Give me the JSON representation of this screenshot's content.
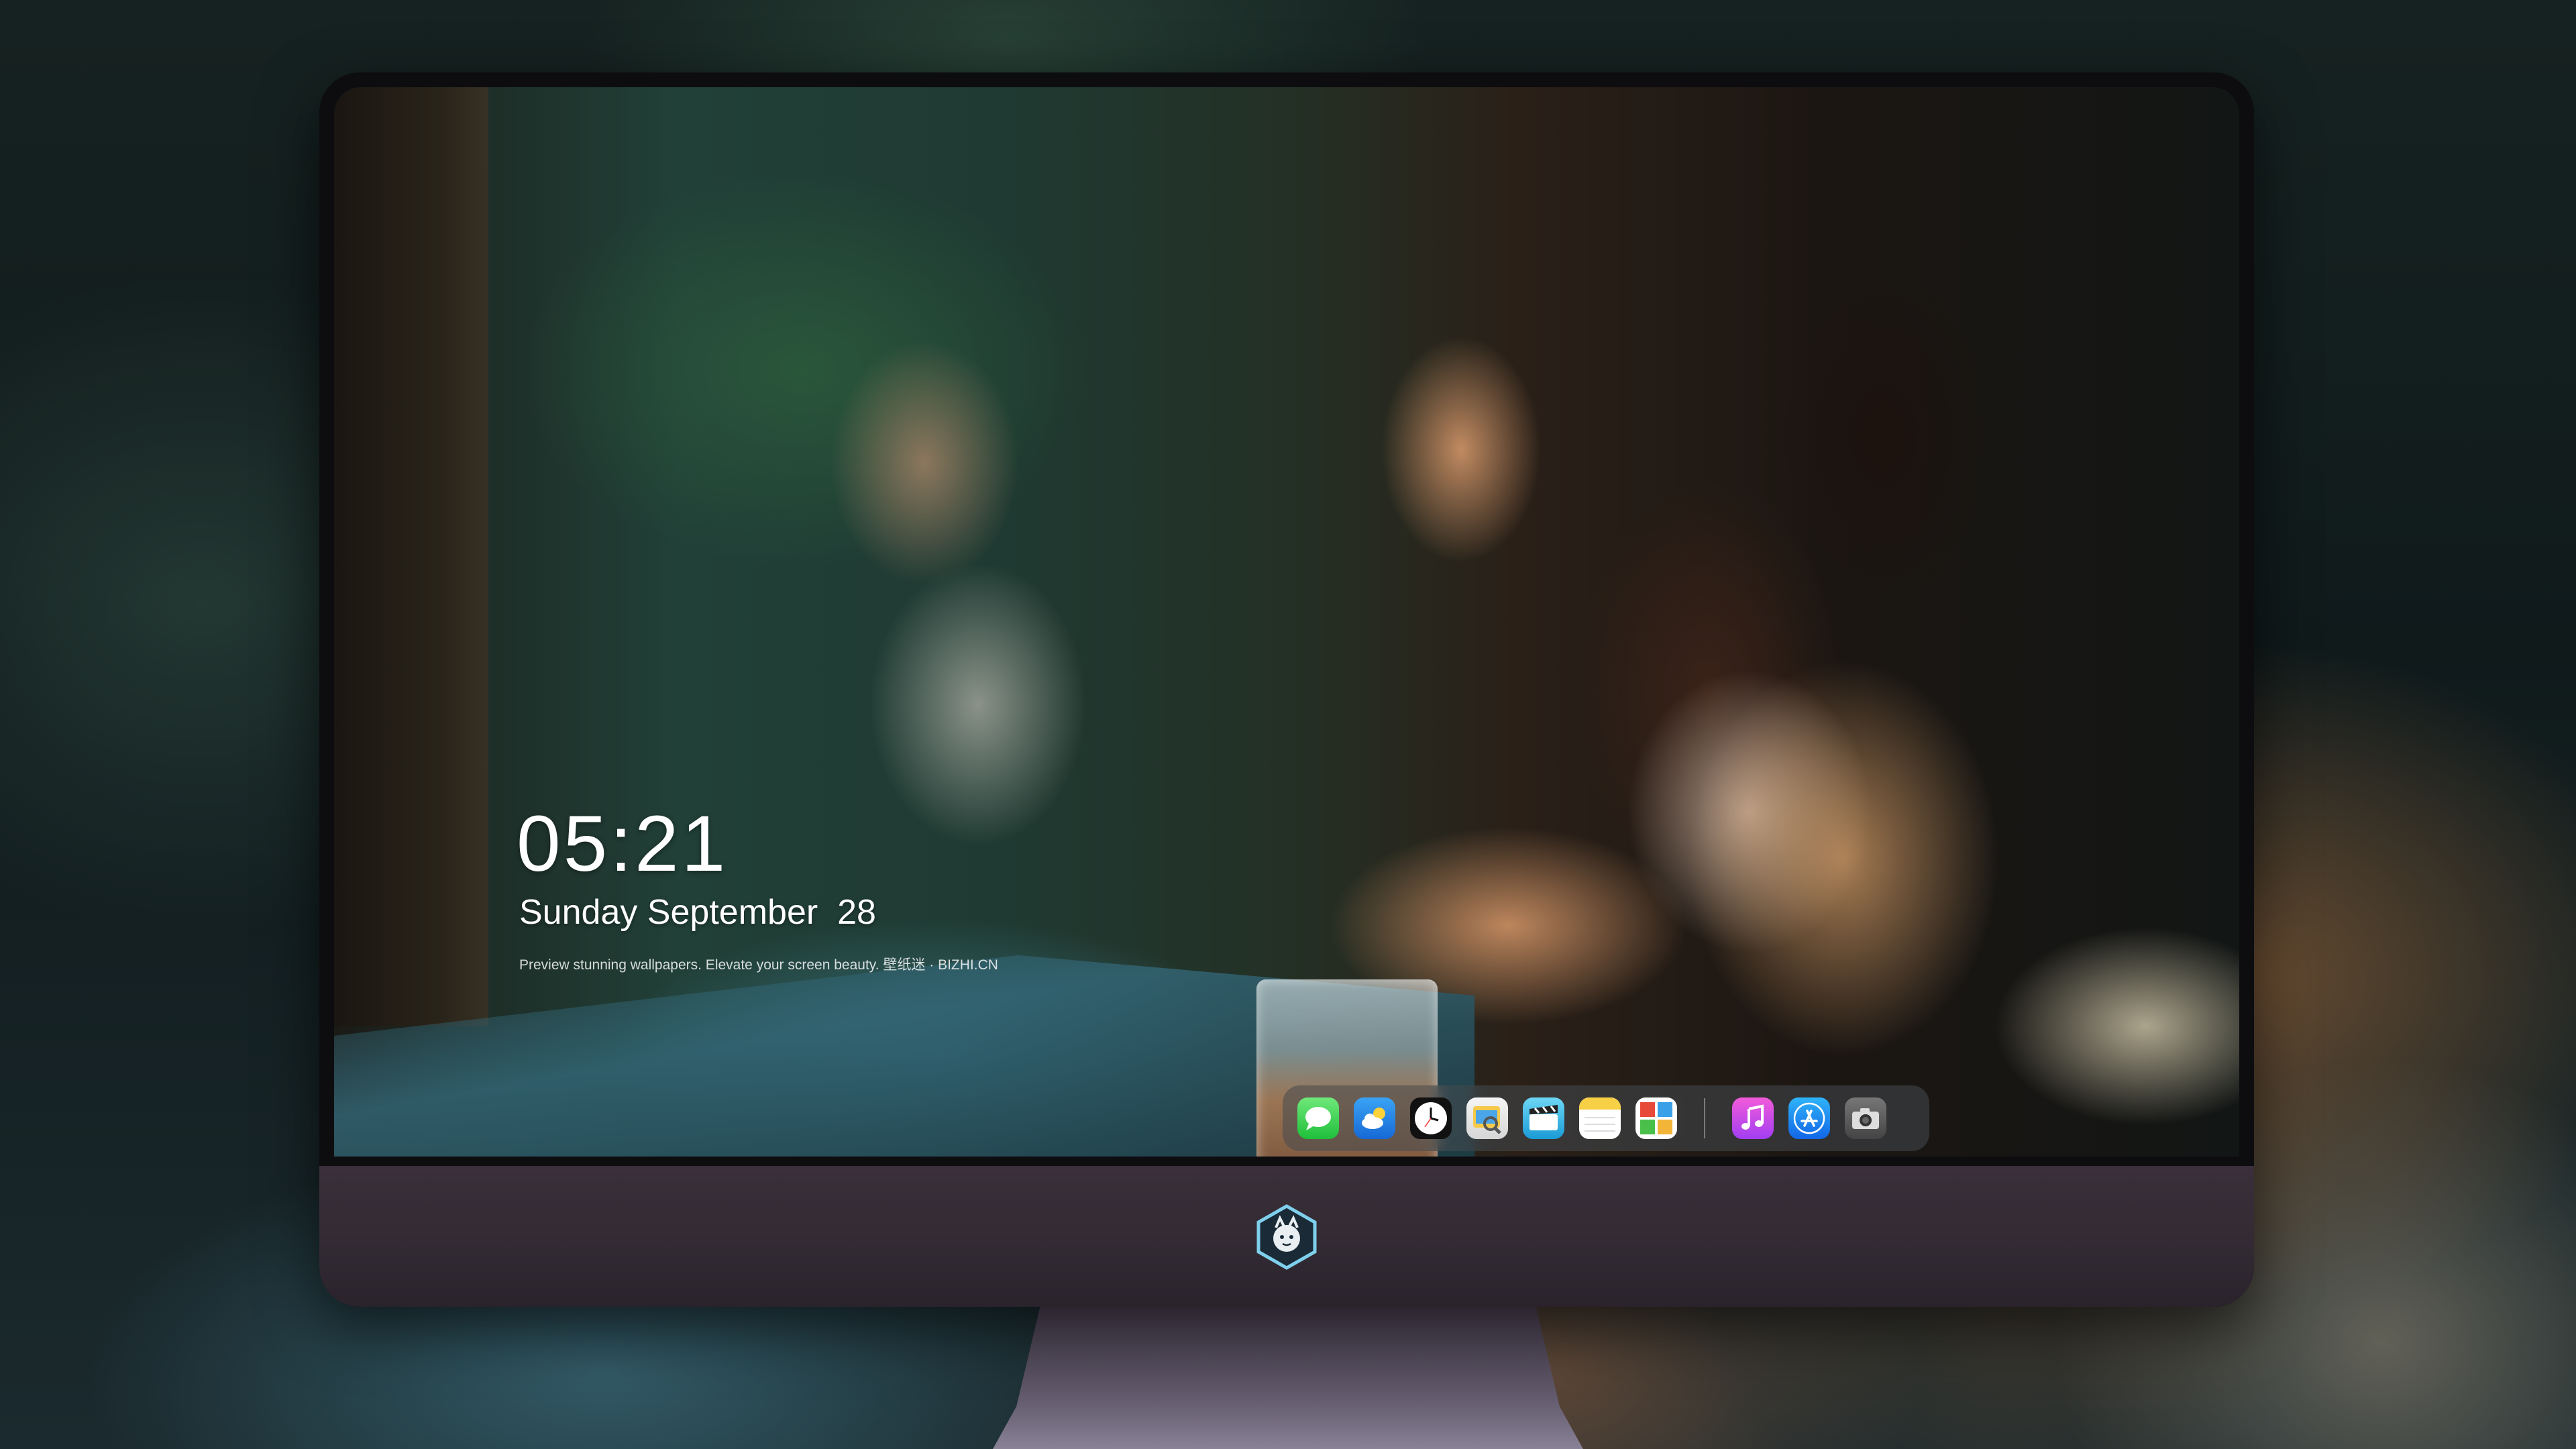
{
  "lock_screen": {
    "time": "05:21",
    "date": "Sunday September  28",
    "tagline": "Preview stunning wallpapers. Elevate your screen beauty. 壁纸迷 · BIZHI.CN"
  },
  "dock": {
    "apps": [
      {
        "name": "Messages",
        "icon": "messages-icon"
      },
      {
        "name": "Weather",
        "icon": "weather-icon"
      },
      {
        "name": "Clock",
        "icon": "clock-icon"
      },
      {
        "name": "Preview",
        "icon": "preview-icon"
      },
      {
        "name": "Clips",
        "icon": "clips-icon"
      },
      {
        "name": "Notes",
        "icon": "notes-icon"
      },
      {
        "name": "Photo Booth",
        "icon": "photo-booth-icon"
      },
      {
        "name": "iTunes",
        "icon": "itunes-icon"
      },
      {
        "name": "App Store",
        "icon": "app-store-icon"
      },
      {
        "name": "Camera",
        "icon": "camera-icon"
      }
    ]
  },
  "colors": {
    "bezel": "#0d0d10",
    "chin": "#322a33",
    "dock_bg": "rgba(70,75,80,0.55)",
    "text": "#ffffff"
  }
}
